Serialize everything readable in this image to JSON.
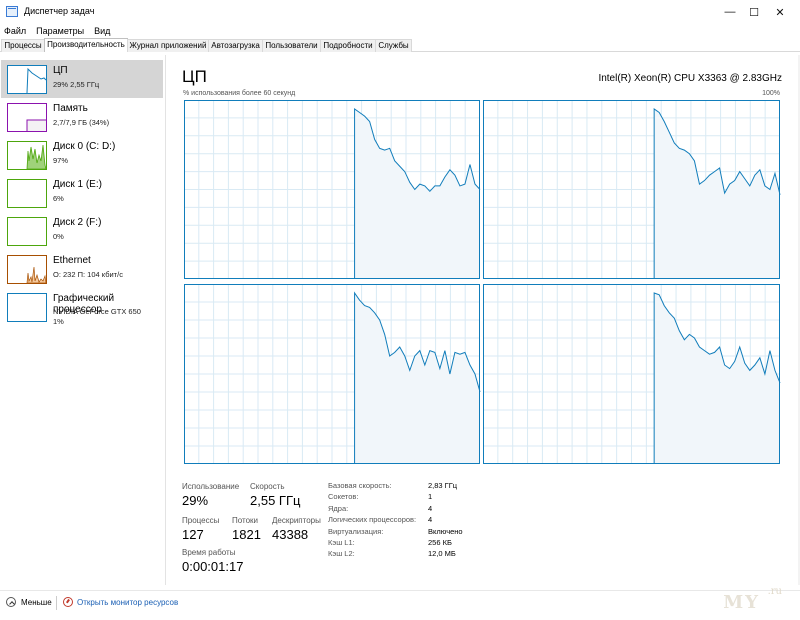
{
  "window": {
    "title": "Диспетчер задач",
    "minimize": "—",
    "maximize": "☐",
    "close": "✕"
  },
  "menu": [
    "Файл",
    "Параметры",
    "Вид"
  ],
  "tabs": [
    "Процессы",
    "Производительность",
    "Журнал приложений",
    "Автозагрузка",
    "Пользователи",
    "Подробности",
    "Службы"
  ],
  "active_tab_index": 1,
  "sidebar": [
    {
      "name": "ЦП",
      "line2": "29% 2,55 ГГц",
      "line3": "",
      "color": "#117dbb",
      "fill": "#f1f6fa"
    },
    {
      "name": "Память",
      "line2": "2,7/7,9 ГБ (34%)",
      "line3": "",
      "color": "#8b12ae",
      "fill": "#f4f2f4"
    },
    {
      "name": "Диск 0 (C: D:)",
      "line2": "97%",
      "line3": "",
      "color": "#4da60c",
      "fill": "#eff7e8"
    },
    {
      "name": "Диск 1 (E:)",
      "line2": "6%",
      "line3": "",
      "color": "#4da60c",
      "fill": "#eff7e8"
    },
    {
      "name": "Диск 2 (F:)",
      "line2": "0%",
      "line3": "",
      "color": "#4da60c",
      "fill": "#eff7e8"
    },
    {
      "name": "Ethernet",
      "line2": "О: 232 П: 104 кбит/с",
      "line3": "",
      "color": "#a74f01",
      "fill": "#fcf3eb"
    },
    {
      "name": "Графический процессор",
      "line2": "NVIDIA GeForce GTX 650",
      "line3": "1%",
      "color": "#117dbb",
      "fill": "#f1f6fa"
    }
  ],
  "main": {
    "title": "ЦП",
    "model": "Intel(R) Xeon(R) CPU X3363 @ 2.83GHz",
    "util_label": "% использования более 60 секунд",
    "pct_label": "100%"
  },
  "chart_data": {
    "type": "area",
    "description_ref": "4 per-core CPU usage graphs, 60 samples each, values in % (0-100)",
    "ylim": [
      0,
      100
    ],
    "series": [
      {
        "name": "",
        "values": [
          0,
          0,
          0,
          0,
          0,
          0,
          0,
          0,
          0,
          0,
          0,
          0,
          0,
          0,
          0,
          0,
          0,
          0,
          0,
          0,
          0,
          0,
          0,
          0,
          0,
          0,
          0,
          0,
          0,
          0,
          0,
          0,
          0,
          0,
          95,
          93,
          91,
          88,
          78,
          73,
          72,
          73,
          66,
          63,
          60,
          54,
          50,
          53,
          52,
          49,
          52,
          52,
          57,
          61,
          58,
          52,
          53,
          64,
          53,
          50
        ]
      },
      {
        "name": "",
        "values": [
          0,
          0,
          0,
          0,
          0,
          0,
          0,
          0,
          0,
          0,
          0,
          0,
          0,
          0,
          0,
          0,
          0,
          0,
          0,
          0,
          0,
          0,
          0,
          0,
          0,
          0,
          0,
          0,
          0,
          0,
          0,
          0,
          0,
          0,
          95,
          93,
          88,
          82,
          76,
          73,
          72,
          70,
          66,
          53,
          55,
          58,
          60,
          62,
          48,
          53,
          55,
          60,
          56,
          52,
          58,
          61,
          52,
          50,
          59,
          47
        ]
      },
      {
        "name": "",
        "values": [
          0,
          0,
          0,
          0,
          0,
          0,
          0,
          0,
          0,
          0,
          0,
          0,
          0,
          0,
          0,
          0,
          0,
          0,
          0,
          0,
          0,
          0,
          0,
          0,
          0,
          0,
          0,
          0,
          0,
          0,
          0,
          0,
          0,
          0,
          95,
          91,
          88,
          87,
          84,
          80,
          72,
          60,
          62,
          65,
          60,
          52,
          60,
          63,
          55,
          63,
          62,
          53,
          63,
          50,
          62,
          61,
          62,
          55,
          50,
          40
        ]
      },
      {
        "name": "",
        "values": [
          0,
          0,
          0,
          0,
          0,
          0,
          0,
          0,
          0,
          0,
          0,
          0,
          0,
          0,
          0,
          0,
          0,
          0,
          0,
          0,
          0,
          0,
          0,
          0,
          0,
          0,
          0,
          0,
          0,
          0,
          0,
          0,
          0,
          0,
          95,
          94,
          88,
          84,
          81,
          74,
          69,
          72,
          70,
          65,
          63,
          61,
          62,
          65,
          55,
          53,
          57,
          65,
          56,
          52,
          55,
          59,
          50,
          63,
          52,
          45
        ]
      }
    ]
  },
  "stats": [
    {
      "label": "Использование",
      "value": "29%"
    },
    {
      "label": "Скорость",
      "value": "2,55 ГГц"
    },
    {
      "label": "Процессы",
      "value": "127"
    },
    {
      "label": "Потоки",
      "value": "1821"
    },
    {
      "label": "Дескрипторы",
      "value": "43388"
    },
    {
      "label": "Время работы",
      "value": "0:00:01:17"
    }
  ],
  "specs": [
    {
      "label": "Базовая скорость:",
      "value": "2,83 ГГц"
    },
    {
      "label": "Сокетов:",
      "value": "1"
    },
    {
      "label": "Ядра:",
      "value": "4"
    },
    {
      "label": "Логических процессоров:",
      "value": "4"
    },
    {
      "label": "Виртуализация:",
      "value": "Включено"
    },
    {
      "label": "Кэш L1:",
      "value": "256 КБ"
    },
    {
      "label": "Кэш L2:",
      "value": "12,0 МБ"
    }
  ],
  "footer": {
    "less": "Меньше",
    "resource_monitor": "Открыть монитор ресурсов"
  },
  "watermark": {
    "main": "MY",
    "small": ".ru"
  },
  "accent_color": "#117dbb"
}
